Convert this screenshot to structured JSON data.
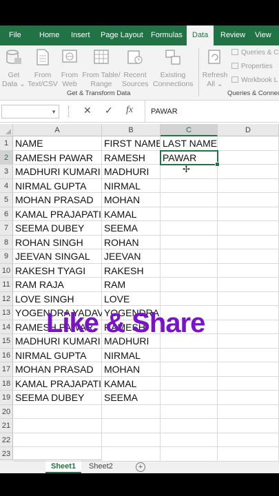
{
  "ribbon_tabs": [
    {
      "label": "File"
    },
    {
      "label": "Home"
    },
    {
      "label": "Insert"
    },
    {
      "label": "Page Layout"
    },
    {
      "label": "Formulas"
    },
    {
      "label": "Data"
    },
    {
      "label": "Review"
    },
    {
      "label": "View"
    }
  ],
  "active_tab": "Data",
  "ribbon": {
    "get_data": [
      "Get",
      "Data ⌄"
    ],
    "from_text_csv": [
      "From",
      "Text/CSV"
    ],
    "from_web": [
      "From",
      "Web"
    ],
    "from_table_range": [
      "From Table/",
      "Range"
    ],
    "recent_sources": [
      "Recent",
      "Sources"
    ],
    "existing_connections": [
      "Existing",
      "Connections"
    ],
    "group_get_transform": "Get & Transform Data",
    "refresh_all": [
      "Refresh",
      "All ⌄"
    ],
    "queries_connections": "Queries & C",
    "properties": "Properties",
    "workbook_links": "Workbook L",
    "group_queries": "Queries & Connect"
  },
  "formula_bar": {
    "name_box": "",
    "cancel_icon": "✕",
    "enter_icon": "✓",
    "fx_label": "fx",
    "content": "PAWAR"
  },
  "columns": [
    "A",
    "B",
    "C",
    "D"
  ],
  "rows": [
    {
      "num": "1",
      "a": "NAME",
      "b": "FIRST NAME",
      "c": "LAST NAME"
    },
    {
      "num": "2",
      "a": "RAMESH PAWAR",
      "b": "RAMESH",
      "c": "PAWAR"
    },
    {
      "num": "3",
      "a": "MADHURI KUMARI",
      "b": "MADHURI",
      "c": ""
    },
    {
      "num": "4",
      "a": "NIRMAL GUPTA",
      "b": "NIRMAL",
      "c": ""
    },
    {
      "num": "5",
      "a": "MOHAN PRASAD",
      "b": "MOHAN",
      "c": ""
    },
    {
      "num": "6",
      "a": "KAMAL PRAJAPATI",
      "b": "KAMAL",
      "c": ""
    },
    {
      "num": "7",
      "a": "SEEMA DUBEY",
      "b": "SEEMA",
      "c": ""
    },
    {
      "num": "8",
      "a": "ROHAN SINGH",
      "b": "ROHAN",
      "c": ""
    },
    {
      "num": "9",
      "a": "JEEVAN SINGAL",
      "b": "JEEVAN",
      "c": ""
    },
    {
      "num": "10",
      "a": "RAKESH TYAGI",
      "b": "RAKESH",
      "c": ""
    },
    {
      "num": "11",
      "a": "RAM RAJA",
      "b": "RAM",
      "c": ""
    },
    {
      "num": "12",
      "a": "LOVE SINGH",
      "b": "LOVE",
      "c": ""
    },
    {
      "num": "13",
      "a": "YOGENDRA YADAV",
      "b": "YOGENDRA",
      "c": ""
    },
    {
      "num": "14",
      "a": "RAMESH PAWAR",
      "b": "RAMESH",
      "c": ""
    },
    {
      "num": "15",
      "a": "MADHURI KUMARI",
      "b": "MADHURI",
      "c": ""
    },
    {
      "num": "16",
      "a": "NIRMAL GUPTA",
      "b": "NIRMAL",
      "c": ""
    },
    {
      "num": "17",
      "a": "MOHAN PRASAD",
      "b": "MOHAN",
      "c": ""
    },
    {
      "num": "18",
      "a": "KAMAL PRAJAPATI",
      "b": "KAMAL",
      "c": ""
    },
    {
      "num": "19",
      "a": "SEEMA DUBEY",
      "b": "SEEMA",
      "c": ""
    },
    {
      "num": "20",
      "a": "",
      "b": "",
      "c": ""
    },
    {
      "num": "21",
      "a": "",
      "b": "",
      "c": ""
    },
    {
      "num": "22",
      "a": "",
      "b": "",
      "c": ""
    },
    {
      "num": "23",
      "a": "",
      "b": "",
      "c": ""
    }
  ],
  "active_cell": {
    "column": "C",
    "row": "2"
  },
  "overlay_text": "Like & Share",
  "sheets": [
    {
      "label": "Sheet1"
    },
    {
      "label": "Sheet2"
    }
  ],
  "active_sheet": "Sheet1",
  "add_sheet_icon": "+",
  "colors": {
    "excel_green": "#217346",
    "overlay_purple": "#7a12c9"
  }
}
